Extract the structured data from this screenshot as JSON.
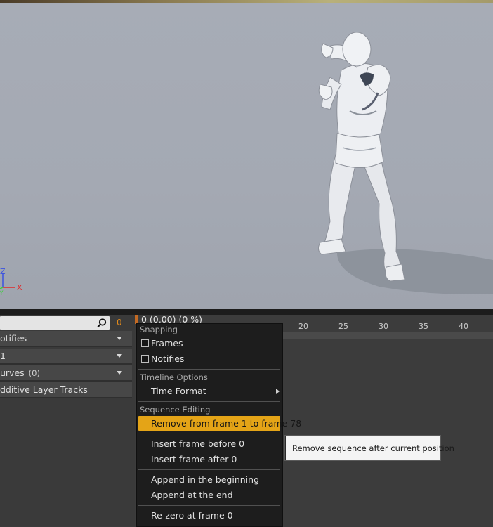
{
  "viewport": {
    "axis_labels": {
      "z": "Z",
      "x": "X",
      "y": "Y"
    },
    "colors": {
      "z_axis": "#3b52e0",
      "x_axis": "#e02a2a",
      "y_axis": "#3bd03b"
    }
  },
  "left_panel": {
    "search": {
      "value": "",
      "placeholder": ""
    },
    "search_count": "0",
    "tracks": [
      {
        "label": "otifies",
        "count": "",
        "has_dropdown": true
      },
      {
        "label": "1",
        "count": "",
        "has_dropdown": true
      },
      {
        "label": "urves",
        "count": "(0)",
        "has_dropdown": true
      },
      {
        "label": "dditive Layer Tracks",
        "count": "",
        "has_dropdown": false
      }
    ]
  },
  "timeline": {
    "current_frame": "0 (0,00) (0 %)",
    "ruler_ticks": [
      "20",
      "25",
      "30",
      "35",
      "40"
    ],
    "colors": {
      "scrub_line": "#2c9c3b",
      "scrub_head": "#c46a23"
    }
  },
  "context_menu": {
    "snapping_header": "Snapping",
    "frames_label": "Frames",
    "frames_checked": false,
    "notifies_label": "Notifies",
    "notifies_checked": false,
    "timeline_options_header": "Timeline Options",
    "time_format_label": "Time Format",
    "sequence_editing_header": "Sequence Editing",
    "remove_from_label": "Remove from frame 1 to frame 78",
    "insert_before_label": "Insert frame before 0",
    "insert_after_label": "Insert frame after 0",
    "append_beginning_label": "Append in the beginning",
    "append_end_label": "Append at the end",
    "rezero_label": "Re-zero at frame 0",
    "highlight_color": "#e4a417"
  },
  "tooltip": {
    "text": "Remove sequence after current position"
  }
}
